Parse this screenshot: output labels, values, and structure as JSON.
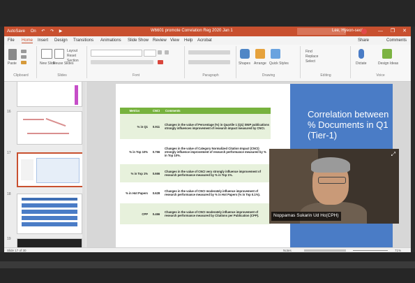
{
  "window": {
    "title": "W6601 promote Correlation Reg 2020 Jan 1",
    "user": "Lee, Hyeon-seok",
    "quick_access": [
      "AutoSave",
      "On",
      "↶",
      "↷",
      "▶"
    ],
    "controls": [
      "—",
      "❒",
      "✕"
    ]
  },
  "menu": {
    "tabs": [
      "File",
      "Home",
      "Insert",
      "Design",
      "Transitions",
      "Animations",
      "Slide Show",
      "Review",
      "View",
      "Help",
      "Acrobat"
    ],
    "active": "Home",
    "share": "Share",
    "comments": "Comments"
  },
  "ribbon": {
    "groups": [
      "Clipboard",
      "Slides",
      "Font",
      "Paragraph",
      "Drawing",
      "Editing",
      "Voice"
    ],
    "paste_label": "Paste",
    "new_slide_label": "New Slide",
    "reuse_label": "Reuse Slides",
    "layout_label": "Layout",
    "reset_label": "Reset",
    "section_label": "Section",
    "shapes_label": "Shapes",
    "arrange_label": "Arrange",
    "quick_styles_label": "Quick Styles",
    "find_label": "Find",
    "replace_label": "Replace",
    "select_label": "Select",
    "dictate_label": "Dictate",
    "design_ideas_label": "Design Ideas"
  },
  "thumbnails": {
    "numbers": [
      "16",
      "17",
      "18",
      "19"
    ]
  },
  "slide": {
    "title": "Correlation between % Documents in Q1 (Tier-1)",
    "table": {
      "headers": [
        "Metrics",
        "CNCI",
        "Comments"
      ],
      "rows": [
        {
          "metric": "% in Q1",
          "cnci": "0.911",
          "comment": "Changes in the value of Percentage (%) in Quartile 1 (Q1) SNIP publications strongly influences improvement of research impact measured by CNCI."
        },
        {
          "metric": "% in Top 10%",
          "cnci": "0.766",
          "comment": "Changes in the value of Category Normalized Citation Impact (CNCI) strongly influence improvement of research performance measured by % in Top 10%."
        },
        {
          "metric": "% in Top 1%",
          "cnci": "0.666",
          "comment": "Changes in the value of CNCI very strongly influence improvement of research performance measured by % in Top 1%."
        },
        {
          "metric": "% in Hot Papers",
          "cnci": "0.628",
          "comment": "Changes in the value of CNCI moderately influence improvement of research performance measured by % in Hot Papers (% in Top 0.1%)."
        },
        {
          "metric": "CPP",
          "cnci": "0.466",
          "comment": "Changes in the value of CNCI moderately influence improvement of research performance measured by Citations per Publication (CPP)."
        }
      ]
    }
  },
  "video": {
    "caption": "Noppamas Sukarin Ud Ho(CPH)"
  },
  "statusbar": {
    "slide_info": "Slide 17 of 30",
    "notes": "Notes",
    "zoom": "71%"
  },
  "colors": {
    "accent": "#c8502f",
    "slide_panel": "#4a7cc6",
    "table_header": "#77b23e"
  }
}
